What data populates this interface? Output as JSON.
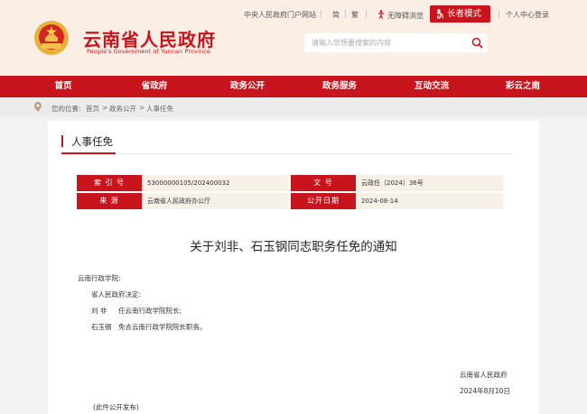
{
  "header": {
    "title": "云南省人民政府",
    "subtitle": "People's Government of Yunnan Province",
    "links": {
      "central_portal": "中央人民政府门户网站",
      "simplified": "简",
      "traditional": "繁",
      "accessibility": "无障碍浏览",
      "elder_mode": "长者模式",
      "personal_center": "个人中心登录"
    },
    "search": {
      "placeholder": "请输入您想要搜索的内容"
    }
  },
  "nav": {
    "items": [
      "首页",
      "省政府",
      "政务公开",
      "政务服务",
      "互动交流",
      "彩云之南"
    ]
  },
  "breadcrumb": {
    "prefix": "您的位置:",
    "items": [
      "首页",
      "政务公开",
      "人事任免"
    ],
    "separator": ">"
  },
  "section": {
    "title": "人事任免"
  },
  "meta": {
    "index_label": "索 引 号",
    "index_value": "53000000105/202400032",
    "doc_no_label": "文 号",
    "doc_no_value": "云政任〔2024〕36号",
    "source_label": "来 源",
    "source_value": "云南省人民政府办公厅",
    "date_label": "公开日期",
    "date_value": "2024-08-14"
  },
  "article": {
    "title": "关于刘非、石玉钢同志职务任免的通知",
    "recipient": "云南行政学院:",
    "decision": "省人民政府决定:",
    "line1_name": "刘 非",
    "line1_text": "任云南行政学院院长;",
    "line2_name": "石玉钢",
    "line2_text": "免去云南行政学院院长职务。",
    "signature": "云南省人民政府",
    "date": "2024年8月10日",
    "note": "(此件公开发布)"
  },
  "colors": {
    "brand_red": "#c8151d",
    "header_bg": "#fbeee5",
    "meta_bg": "#f7f0e6"
  }
}
